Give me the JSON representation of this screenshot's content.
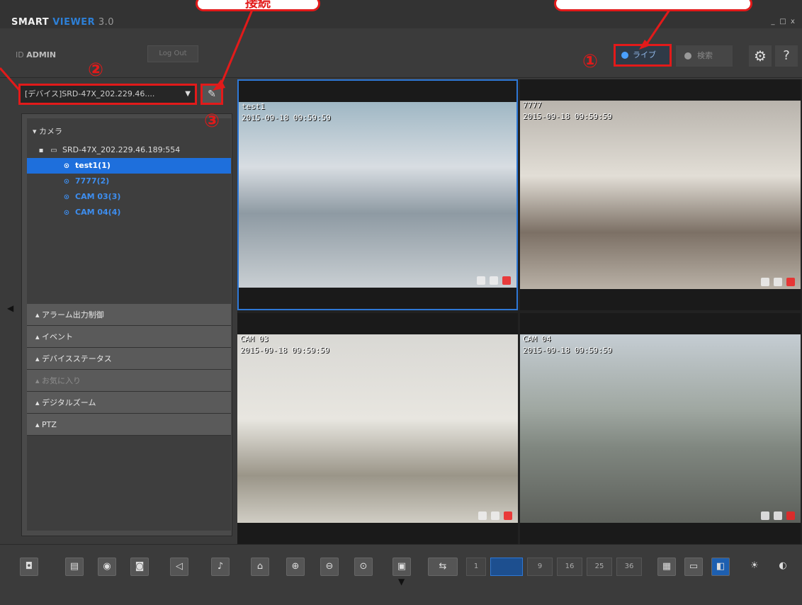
{
  "app": {
    "name_a": "SMART ",
    "name_b": "VIEWER",
    "version": " 3.0"
  },
  "window": {
    "minimize": "_",
    "maximize": "□",
    "close": "x"
  },
  "user": {
    "prefix": "ID ",
    "name": "ADMIN",
    "logout": "Log Out"
  },
  "modes": {
    "live": "ライブ",
    "search": "検索"
  },
  "header_icons": {
    "settings": "gear-icon",
    "help": "?"
  },
  "device": {
    "selected": "[デバイス]SRD-47X_202.229.46....",
    "caret": "▼",
    "edit_icon": "✎"
  },
  "camera_section": {
    "label": "カメラ"
  },
  "tree": {
    "device": "SRD-47X_202.229.46.189:554",
    "cameras": [
      {
        "label": "test1(1)",
        "selected": true
      },
      {
        "label": "7777(2)",
        "selected": false
      },
      {
        "label": "CAM 03(3)",
        "selected": false
      },
      {
        "label": "CAM 04(4)",
        "selected": false
      }
    ]
  },
  "accordion": [
    {
      "label": "アラーム出力制御",
      "enabled": true
    },
    {
      "label": "イベント",
      "enabled": true
    },
    {
      "label": "デバイスステータス",
      "enabled": true
    },
    {
      "label": "お気に入り",
      "enabled": false
    },
    {
      "label": "デジタルズーム",
      "enabled": true
    },
    {
      "label": "PTZ",
      "enabled": true
    }
  ],
  "annotations": {
    "badge1": "①",
    "badge2": "②",
    "badge3": "③",
    "callout_top": "接続"
  },
  "tiles": [
    {
      "name": "test1",
      "timestamp": "2015-09-18 09:59:59"
    },
    {
      "name": "7777",
      "timestamp": "2015-09-18 09:59:59"
    },
    {
      "name": "CAM 03",
      "timestamp": "2015-09-18 09:59:59"
    },
    {
      "name": "CAM 04",
      "timestamp": "2015-09-18 09:59:59"
    }
  ],
  "toolbar": {
    "layouts": [
      "1",
      "",
      "9",
      "16",
      "25",
      "36"
    ],
    "active_layout": 1
  },
  "colors": {
    "accent": "#2d7fd6",
    "highlight": "#e21a1a",
    "selected_row": "#1e6fdc"
  }
}
